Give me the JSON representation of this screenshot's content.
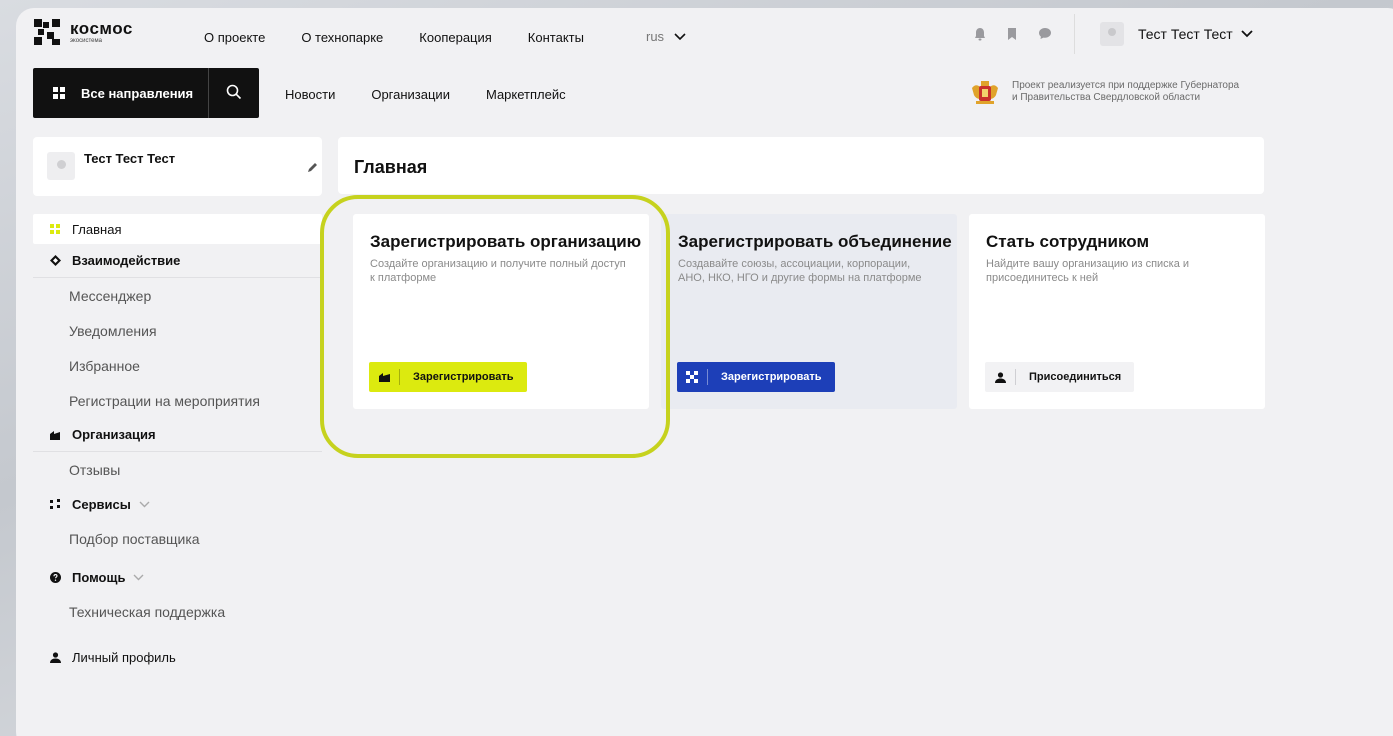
{
  "header": {
    "logo_title": "космос",
    "logo_subtitle": "экосистема",
    "nav": [
      "О проекте",
      "О технопарке",
      "Кооперация",
      "Контакты"
    ],
    "lang": "rus",
    "user_name": "Тест Тест Тест"
  },
  "subheader": {
    "all_directions": "Все направления",
    "nav": [
      "Новости",
      "Организации",
      "Маркетплейс"
    ],
    "support_line1": "Проект реализуется при поддержке Губернатора",
    "support_line2": "и Правительства Свердловской области"
  },
  "profile": {
    "name": "Тест Тест Тест"
  },
  "sidebar": {
    "main": "Главная",
    "interaction": "Взаимодействие",
    "interaction_items": [
      "Мессенджер",
      "Уведомления",
      "Избранное",
      "Регистрации на мероприятия"
    ],
    "organization": "Организация",
    "organization_items": [
      "Отзывы"
    ],
    "services": "Сервисы",
    "services_items": [
      "Подбор поставщика"
    ],
    "help": "Помощь",
    "help_items": [
      "Техническая поддержка"
    ],
    "personal": "Личный профиль"
  },
  "main": {
    "title": "Главная",
    "cards": [
      {
        "title": "Зарегистрировать организацию",
        "desc": "Создайте организацию и получите полный доступ к платформе",
        "button": "Зарегистрировать"
      },
      {
        "title": "Зарегистрировать объединение",
        "desc": "Создавайте союзы, ассоциации, корпорации, АНО, НКО, НГО и другие формы на платформе",
        "button": "Зарегистрировать"
      },
      {
        "title": "Стать сотрудником",
        "desc": "Найдите вашу организацию из списка и присоединитесь к ней",
        "button": "Присоединиться"
      }
    ]
  },
  "colors": {
    "accent_yellow": "#dcea0f",
    "accent_blue": "#1d3fb8",
    "highlight": "#c6d21e"
  }
}
